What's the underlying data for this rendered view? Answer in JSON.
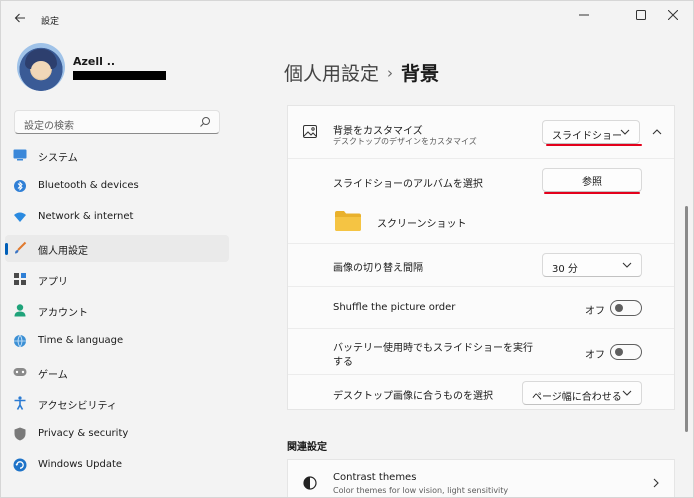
{
  "window": {
    "title": "設定"
  },
  "user": {
    "name": "Azell .."
  },
  "search": {
    "placeholder": "設定の検索"
  },
  "sidebar": {
    "items": [
      {
        "label": "システム",
        "icon": "system-icon"
      },
      {
        "label": "Bluetooth & devices",
        "icon": "bluetooth-icon"
      },
      {
        "label": "Network & internet",
        "icon": "wifi-icon"
      },
      {
        "label": "個人用設定",
        "icon": "brush-icon",
        "active": true
      },
      {
        "label": "アプリ",
        "icon": "apps-icon"
      },
      {
        "label": "アカウント",
        "icon": "account-icon"
      },
      {
        "label": "Time & language",
        "icon": "globe-clock-icon"
      },
      {
        "label": "ゲーム",
        "icon": "gamepad-icon"
      },
      {
        "label": "アクセシビリティ",
        "icon": "accessibility-icon"
      },
      {
        "label": "Privacy & security",
        "icon": "shield-icon"
      },
      {
        "label": "Windows Update",
        "icon": "update-icon"
      }
    ]
  },
  "breadcrumb": {
    "parent": "個人用設定",
    "separator": "›",
    "current": "背景"
  },
  "background": {
    "title": "背景をカスタマイズ",
    "subtitle": "デスクトップのデザインをカスタマイズ",
    "type_value": "スライドショー",
    "album_label": "スライドショーのアルバムを選択",
    "browse_label": "参照",
    "folder_name": "スクリーンショット",
    "interval_label": "画像の切り替え間隔",
    "interval_value": "30 分",
    "shuffle_label": "Shuffle the picture order",
    "shuffle_state": "オフ",
    "battery_label_line1": "バッテリー使用時でもスライドショーを実行",
    "battery_label_line2": "する",
    "battery_state": "オフ",
    "fit_label": "デスクトップ画像に合うものを選択",
    "fit_value": "ページ幅に合わせる"
  },
  "related": {
    "section_title": "関連設定",
    "contrast_title": "Contrast themes",
    "contrast_subtitle": "Color themes for low vision, light sensitivity"
  },
  "colors": {
    "accent": "#005fb8",
    "highlight_red": "#e3001b",
    "folder_yellow": "#f5c443"
  }
}
